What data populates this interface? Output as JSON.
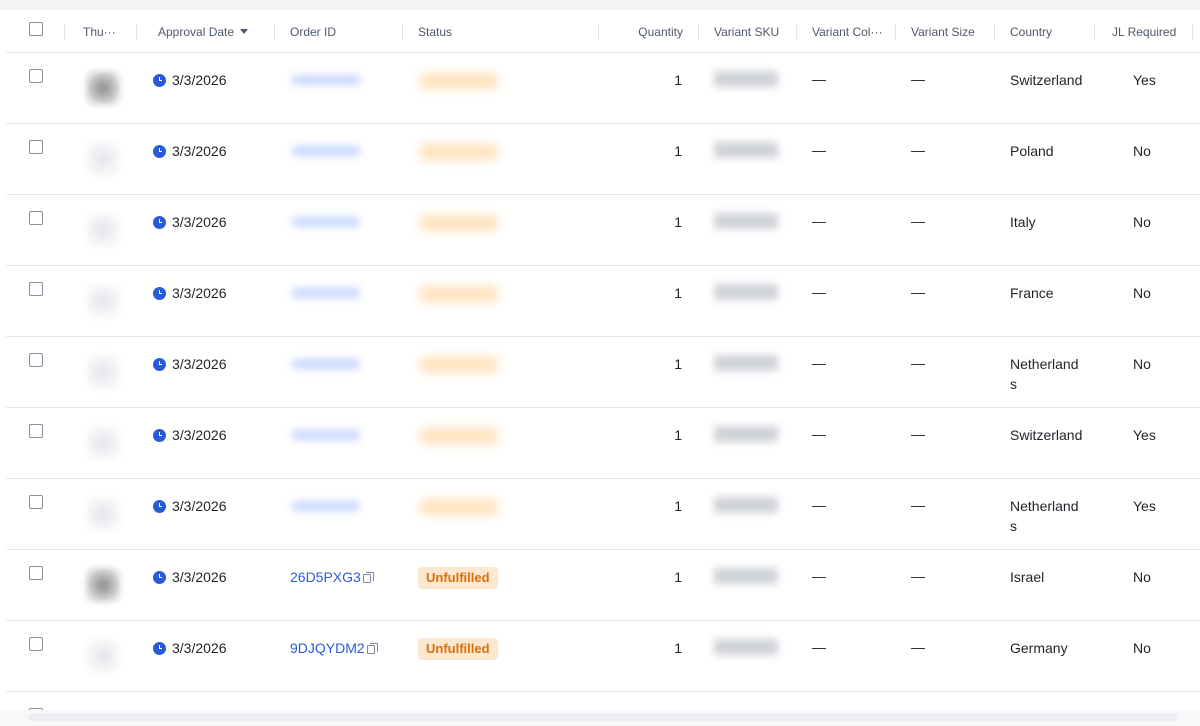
{
  "table": {
    "columns": [
      {
        "key": "thumbnail",
        "label": "Thu···"
      },
      {
        "key": "approval_date",
        "label": "Approval Date",
        "sorted": "desc"
      },
      {
        "key": "order_id",
        "label": "Order ID"
      },
      {
        "key": "status",
        "label": "Status"
      },
      {
        "key": "quantity",
        "label": "Quantity"
      },
      {
        "key": "variant_sku",
        "label": "Variant SKU"
      },
      {
        "key": "variant_color",
        "label": "Variant Col···"
      },
      {
        "key": "variant_size",
        "label": "Variant Size"
      },
      {
        "key": "country",
        "label": "Country"
      },
      {
        "key": "jl_required",
        "label": "JL Required"
      }
    ],
    "rows": [
      {
        "approval_date": "3/3/2026",
        "order_id": "",
        "status": "",
        "quantity": "1",
        "variant_color": "—",
        "variant_size": "—",
        "country": "Switzerland",
        "jl_required": "Yes"
      },
      {
        "approval_date": "3/3/2026",
        "order_id": "",
        "status": "",
        "quantity": "1",
        "variant_color": "—",
        "variant_size": "—",
        "country": "Poland",
        "jl_required": "No"
      },
      {
        "approval_date": "3/3/2026",
        "order_id": "",
        "status": "",
        "quantity": "1",
        "variant_color": "—",
        "variant_size": "—",
        "country": "Italy",
        "jl_required": "No"
      },
      {
        "approval_date": "3/3/2026",
        "order_id": "",
        "status": "",
        "quantity": "1",
        "variant_color": "—",
        "variant_size": "—",
        "country": "France",
        "jl_required": "No"
      },
      {
        "approval_date": "3/3/2026",
        "order_id": "",
        "status": "",
        "quantity": "1",
        "variant_color": "—",
        "variant_size": "—",
        "country": "Netherlands",
        "jl_required": "No"
      },
      {
        "approval_date": "3/3/2026",
        "order_id": "",
        "status": "",
        "quantity": "1",
        "variant_color": "—",
        "variant_size": "—",
        "country": "Switzerland",
        "jl_required": "Yes"
      },
      {
        "approval_date": "3/3/2026",
        "order_id": "",
        "status": "",
        "quantity": "1",
        "variant_color": "—",
        "variant_size": "—",
        "country": "Netherlands",
        "jl_required": "Yes"
      },
      {
        "approval_date": "3/3/2026",
        "order_id": "26D5PXG3",
        "status": "Unfulfilled",
        "quantity": "1",
        "variant_color": "—",
        "variant_size": "—",
        "country": "Israel",
        "jl_required": "No"
      },
      {
        "approval_date": "3/3/2026",
        "order_id": "9DJQYDM2",
        "status": "Unfulfilled",
        "quantity": "1",
        "variant_color": "—",
        "variant_size": "—",
        "country": "Germany",
        "jl_required": "No"
      }
    ]
  },
  "colors": {
    "link": "#2a5bd7",
    "status_unfulfilled_bg": "#fde8cf",
    "status_unfulfilled_text": "#d97008",
    "border": "#e6e8eb"
  }
}
